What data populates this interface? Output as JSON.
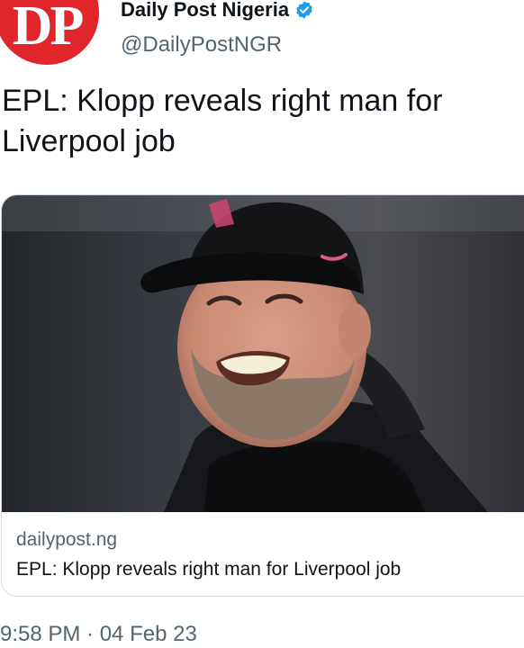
{
  "account": {
    "avatar_text": "DP",
    "display_name": "Daily Post Nigeria",
    "handle": "@DailyPostNGR",
    "verified_icon": "verified-badge-icon",
    "avatar_color": "#e0252b",
    "verified_color": "#1d9bf0"
  },
  "tweet": {
    "text": "EPL: Klopp reveals right man for Liverpool job"
  },
  "card": {
    "domain": "dailypost.ng",
    "title": "EPL: Klopp reveals right man for Liverpool job",
    "image_icon": "photo-of-smiling-man-in-cap"
  },
  "timestamp": "9:58 PM · 04 Feb 23"
}
